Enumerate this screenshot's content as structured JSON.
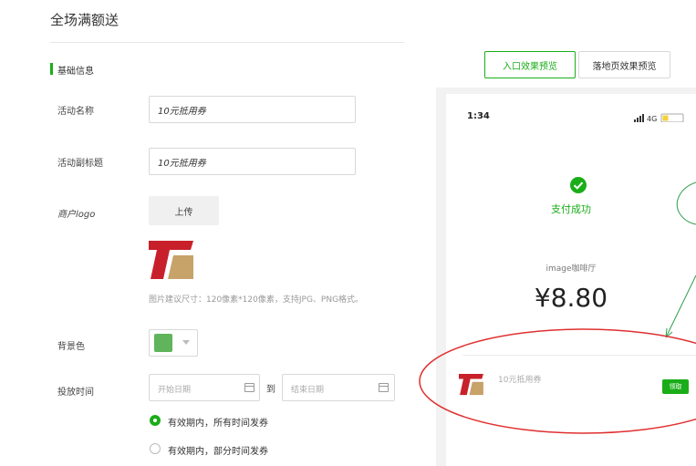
{
  "page": {
    "title": "全场满额送"
  },
  "form": {
    "section_title": "基础信息",
    "fields": {
      "activity_name": {
        "label": "活动名称",
        "value": "10元抵用券"
      },
      "activity_subtitle": {
        "label": "活动副标题",
        "value": "10元抵用券"
      },
      "merchant_logo": {
        "label": "商户logo",
        "upload_label": "上传",
        "hint": "图片建议尺寸：120像素*120像素，支持JPG、PNG格式。"
      },
      "background_color": {
        "label": "背景色",
        "value": "#5fb45c"
      },
      "delivery_time": {
        "label": "投放时间",
        "start_placeholder": "开始日期",
        "separator": "到",
        "end_placeholder": "结束日期",
        "options": [
          {
            "label": "有效期内，所有时间发券",
            "selected": true
          },
          {
            "label": "有效期内，部分时间发券",
            "selected": false
          }
        ]
      }
    }
  },
  "preview": {
    "tabs": [
      {
        "label": "入口效果预览",
        "active": true
      },
      {
        "label": "落地页效果预览",
        "active": false
      }
    ],
    "phone": {
      "time": "1:34",
      "network": "4G",
      "success_text": "支付成功",
      "merchant": "image咖啡厅",
      "amount": "¥8.80",
      "coupon_name": "10元抵用券",
      "claim_label": "领取"
    }
  },
  "colors": {
    "accent": "#1aad19",
    "annotation": "#e03030",
    "arrow": "#2e9e4e"
  },
  "icons": [
    "calendar-icon",
    "check-circle-icon",
    "signal-icon",
    "battery-icon",
    "logo-icon"
  ]
}
